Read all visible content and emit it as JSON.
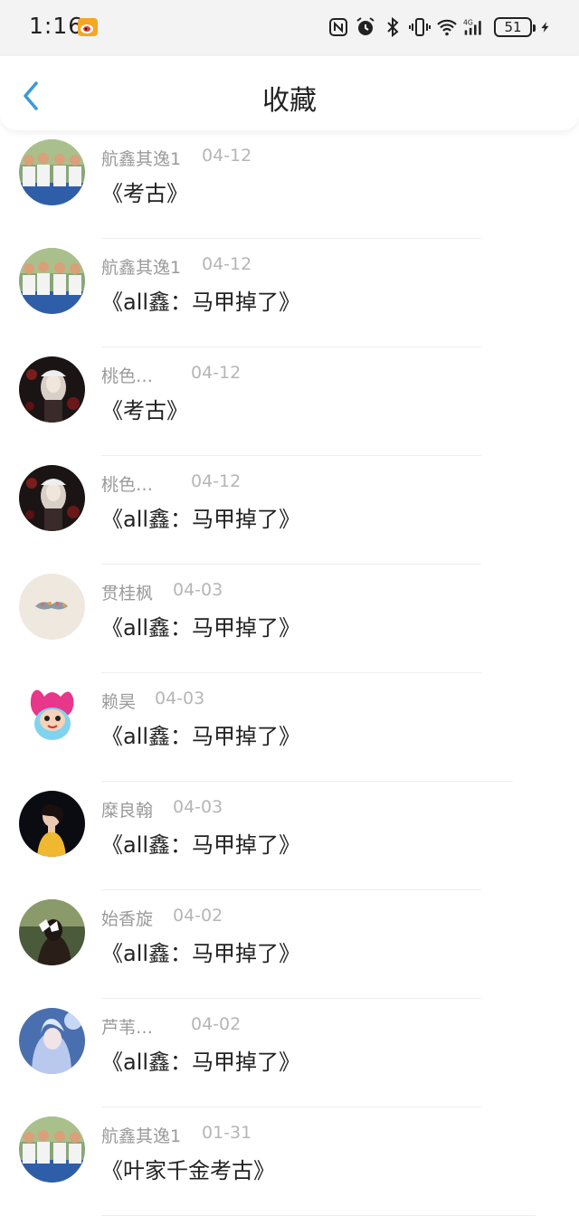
{
  "status_bar": {
    "time": "1:16",
    "battery": "51",
    "network": "4G"
  },
  "header": {
    "title": "收藏"
  },
  "items": [
    {
      "name": "航鑫其逸1",
      "date": "04-12",
      "work": "《考古》",
      "avatar": "group-photo"
    },
    {
      "name": "航鑫其逸1",
      "date": "04-12",
      "work": "《all鑫：马甲掉了》",
      "avatar": "group-photo"
    },
    {
      "name": "桃色…",
      "date": "04-12",
      "work": "《考古》",
      "avatar": "dark-portrait"
    },
    {
      "name": "桃色…",
      "date": "04-12",
      "work": "《all鑫：马甲掉了》",
      "avatar": "dark-portrait"
    },
    {
      "name": "贯桂枫",
      "date": "04-03",
      "work": "《all鑫：马甲掉了》",
      "avatar": "mustache"
    },
    {
      "name": "赖昊",
      "date": "04-03",
      "work": "《all鑫：马甲掉了》",
      "avatar": "cartoon"
    },
    {
      "name": "糜良翰",
      "date": "04-03",
      "work": "《all鑫：马甲掉了》",
      "avatar": "woman-yellow"
    },
    {
      "name": "始香旋",
      "date": "04-02",
      "work": "《all鑫：马甲掉了》",
      "avatar": "girl-bow"
    },
    {
      "name": "芦苇…",
      "date": "04-02",
      "work": "《all鑫：马甲掉了》",
      "avatar": "fantasy-blue"
    },
    {
      "name": "航鑫其逸1",
      "date": "01-31",
      "work": "《叶家千金考古》",
      "avatar": "group-photo"
    }
  ]
}
